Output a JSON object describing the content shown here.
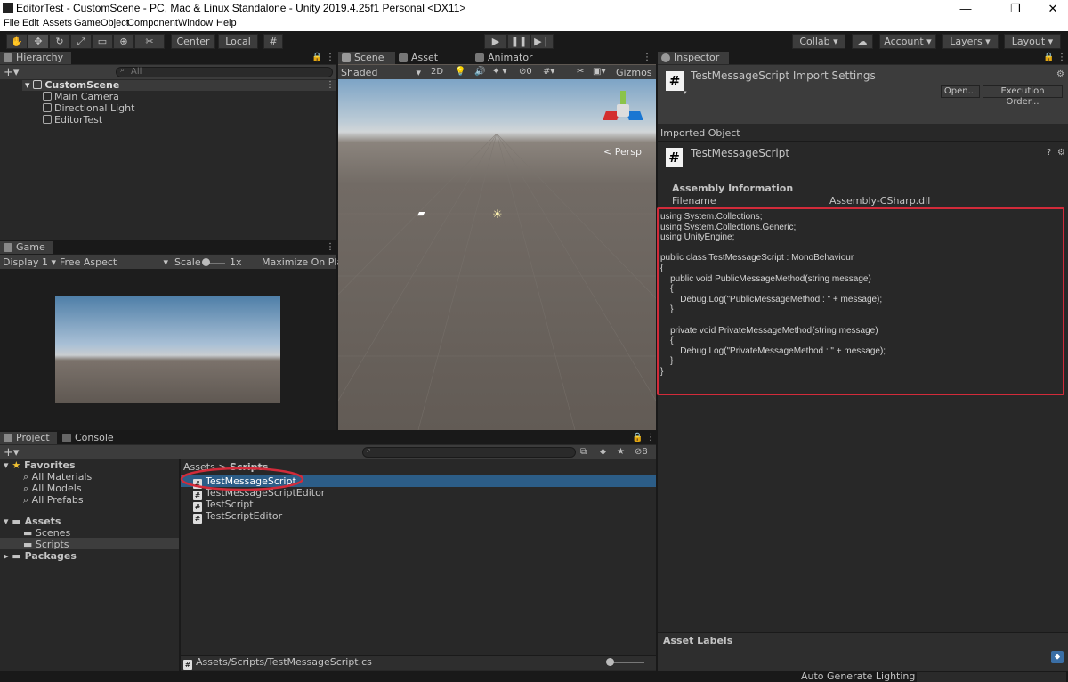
{
  "window": {
    "title": "EditorTest - CustomScene - PC, Mac & Linux Standalone - Unity 2019.4.25f1 Personal <DX11>"
  },
  "menu": [
    "File",
    "Edit",
    "Assets",
    "GameObject",
    "Component",
    "Window",
    "Help"
  ],
  "toolbar": {
    "pivot_center": "Center",
    "pivot_local": "Local",
    "collab": "Collab",
    "account": "Account",
    "layers": "Layers",
    "layout": "Layout"
  },
  "hierarchy": {
    "tab": "Hierarchy",
    "search_placeholder": "All",
    "scene": "CustomScene",
    "objects": [
      "Main Camera",
      "Directional Light",
      "EditorTest"
    ]
  },
  "scene_view": {
    "tabs": [
      "Scene",
      "Asset Store",
      "Animator"
    ],
    "shading": "Shaded",
    "mode_2d": "2D",
    "hidden_count": "0",
    "gizmos": "Gizmos",
    "persp": "Persp"
  },
  "game_view": {
    "tab": "Game",
    "display": "Display 1",
    "aspect": "Free Aspect",
    "scale_label": "Scale",
    "scale_value": "1x",
    "maximize": "Maximize On Play"
  },
  "project": {
    "tabs": [
      "Project",
      "Console"
    ],
    "favorites_label": "Favorites",
    "favorites": [
      "All Materials",
      "All Models",
      "All Prefabs"
    ],
    "assets_label": "Assets",
    "asset_folders": [
      "Scenes",
      "Scripts"
    ],
    "packages_label": "Packages",
    "breadcrumb_root": "Assets",
    "breadcrumb_sep": ">",
    "breadcrumb_leaf": "Scripts",
    "files": [
      "TestMessageScript",
      "TestMessageScriptEditor",
      "TestScript",
      "TestScriptEditor"
    ],
    "selected_path": "Assets/Scripts/TestMessageScript.cs",
    "hidden_count": "8"
  },
  "inspector": {
    "tab": "Inspector",
    "import_title": "TestMessageScript Import Settings",
    "open_button": "Open...",
    "exec_order_button": "Execution Order...",
    "imported_object": "Imported Object",
    "script_name": "TestMessageScript",
    "assembly_info": "Assembly Information",
    "filename_label": "Filename",
    "filename_value": "Assembly-CSharp.dll",
    "code": "using System.Collections;\nusing System.Collections.Generic;\nusing UnityEngine;\n\npublic class TestMessageScript : MonoBehaviour\n{\n    public void PublicMessageMethod(string message)\n    {\n        Debug.Log(\"PublicMessageMethod : \" + message);\n    }\n\n    private void PrivateMessageMethod(string message)\n    {\n        Debug.Log(\"PrivateMessageMethod : \" + message);\n    }\n}",
    "asset_labels": "Asset Labels"
  },
  "statusbar": {
    "text": "Auto Generate Lighting Off"
  },
  "colors": {
    "selection": "#2c5d87",
    "highlight": "#d22b3a",
    "panel": "#282828",
    "tab_active": "#3c3c3c"
  }
}
